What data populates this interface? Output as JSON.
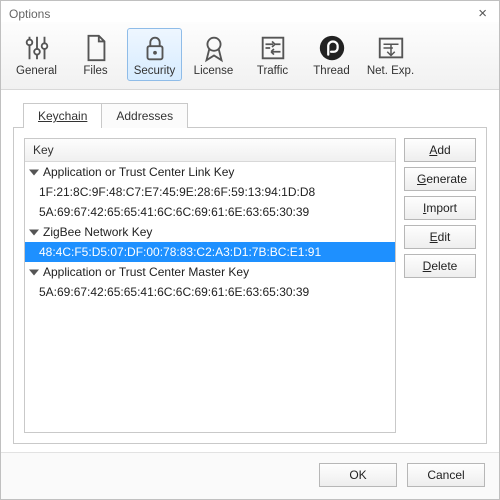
{
  "title": "Options",
  "toolbar": [
    {
      "id": "general",
      "label": "General"
    },
    {
      "id": "files",
      "label": "Files"
    },
    {
      "id": "security",
      "label": "Security",
      "selected": true
    },
    {
      "id": "license",
      "label": "License"
    },
    {
      "id": "traffic",
      "label": "Traffic"
    },
    {
      "id": "thread",
      "label": "Thread"
    },
    {
      "id": "netexp",
      "label": "Net. Exp."
    }
  ],
  "tabs": [
    {
      "id": "keychain",
      "label": "Keychain",
      "active": true
    },
    {
      "id": "addresses",
      "label": "Addresses"
    }
  ],
  "list": {
    "column": "Key",
    "rows": [
      {
        "type": "group",
        "text": "Application or Trust Center Link Key"
      },
      {
        "type": "item",
        "text": "1F:21:8C:9F:48:C7:E7:45:9E:28:6F:59:13:94:1D:D8"
      },
      {
        "type": "item",
        "text": "5A:69:67:42:65:65:41:6C:6C:69:61:6E:63:65:30:39"
      },
      {
        "type": "group",
        "text": "ZigBee Network Key"
      },
      {
        "type": "item",
        "text": "48:4C:F5:D5:07:DF:00:78:83:C2:A3:D1:7B:BC:E1:91",
        "selected": true
      },
      {
        "type": "group",
        "text": "Application or Trust Center Master Key"
      },
      {
        "type": "item",
        "text": "5A:69:67:42:65:65:41:6C:6C:69:61:6E:63:65:30:39"
      }
    ]
  },
  "buttons": {
    "add": "Add",
    "generate": "Generate",
    "import": "Import",
    "edit": "Edit",
    "delete": "Delete",
    "ok": "OK",
    "cancel": "Cancel"
  }
}
